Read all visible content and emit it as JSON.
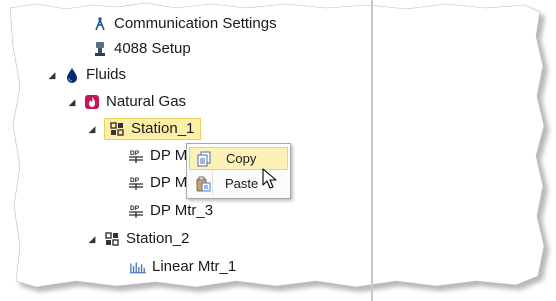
{
  "tree": {
    "items": [
      {
        "id": "comm",
        "label": "Communication Settings",
        "icon": "antenna-icon"
      },
      {
        "id": "setup",
        "label": "4088 Setup",
        "icon": "transmitter-icon"
      },
      {
        "id": "fluids",
        "label": "Fluids",
        "icon": "droplet-icon",
        "expander": "◢"
      },
      {
        "id": "gas",
        "label": "Natural Gas",
        "icon": "flame-icon",
        "expander": "◢"
      },
      {
        "id": "station1",
        "label": "Station_1",
        "icon": "station-icon",
        "expander": "◢"
      },
      {
        "id": "dp1",
        "label": "DP M",
        "icon": "dp-meter-icon"
      },
      {
        "id": "dp2",
        "label": "DP M",
        "icon": "dp-meter-icon"
      },
      {
        "id": "dp3",
        "label": "DP Mtr_3",
        "icon": "dp-meter-icon"
      },
      {
        "id": "station2",
        "label": "Station_2",
        "icon": "station-icon",
        "expander": "◢"
      },
      {
        "id": "linear1",
        "label": "Linear Mtr_1",
        "icon": "linear-meter-icon"
      }
    ]
  },
  "context_menu": {
    "items": [
      {
        "label": "Copy",
        "icon": "copy-icon"
      },
      {
        "label": "Paste",
        "icon": "paste-icon"
      }
    ]
  },
  "colors": {
    "selection_fill": "#fcf0a8",
    "selection_border": "#e6cf5a",
    "fluid_blue": "#0a2a6e",
    "flame_magenta": "#c2185b"
  }
}
